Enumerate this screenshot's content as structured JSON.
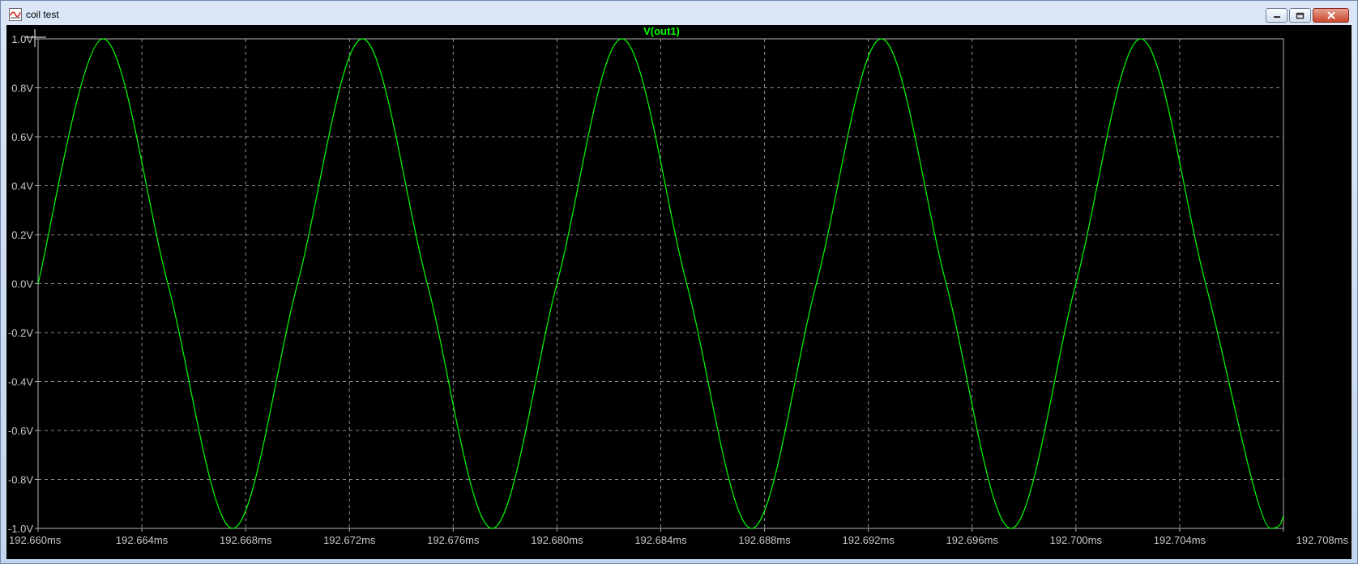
{
  "window": {
    "title": "coil test",
    "icon": "waveform-icon",
    "controls": [
      "minimize-icon",
      "restore-icon",
      "close-icon"
    ]
  },
  "colors": {
    "trace": "#00ff00",
    "background": "#000000",
    "grid": "#8c8c8c",
    "axis_text": "#c8c8c8"
  },
  "chart_data": {
    "type": "line",
    "title": "V(out1)",
    "xlabel": "",
    "ylabel": "",
    "xlim": [
      192.66,
      192.708
    ],
    "ylim": [
      -1.0,
      1.0
    ],
    "grid": true,
    "y_ticks": [
      "1.0V",
      "0.8V",
      "0.6V",
      "0.4V",
      "0.2V",
      "0.0V",
      "-0.2V",
      "-0.4V",
      "-0.6V",
      "-0.8V",
      "-1.0V"
    ],
    "x_ticks": [
      "192.660ms",
      "192.664ms",
      "192.668ms",
      "192.672ms",
      "192.676ms",
      "192.680ms",
      "192.684ms",
      "192.688ms",
      "192.692ms",
      "192.696ms",
      "192.700ms",
      "192.704ms",
      "192.708ms"
    ],
    "series": [
      {
        "name": "V(out1)",
        "x": [
          192.66,
          192.6625,
          192.665,
          192.6675,
          192.67,
          192.6725,
          192.675,
          192.6775,
          192.68,
          192.6825,
          192.685,
          192.6875,
          192.69,
          192.6925,
          192.695,
          192.6975,
          192.7,
          192.7025,
          192.705,
          192.7075,
          192.708
        ],
        "y": [
          0.0,
          1.0,
          0.0,
          -1.0,
          0.0,
          1.0,
          0.0,
          -1.0,
          0.0,
          1.0,
          0.0,
          -1.0,
          0.0,
          1.0,
          0.0,
          -1.0,
          0.0,
          1.0,
          0.0,
          -1.0,
          -0.95
        ]
      }
    ]
  }
}
